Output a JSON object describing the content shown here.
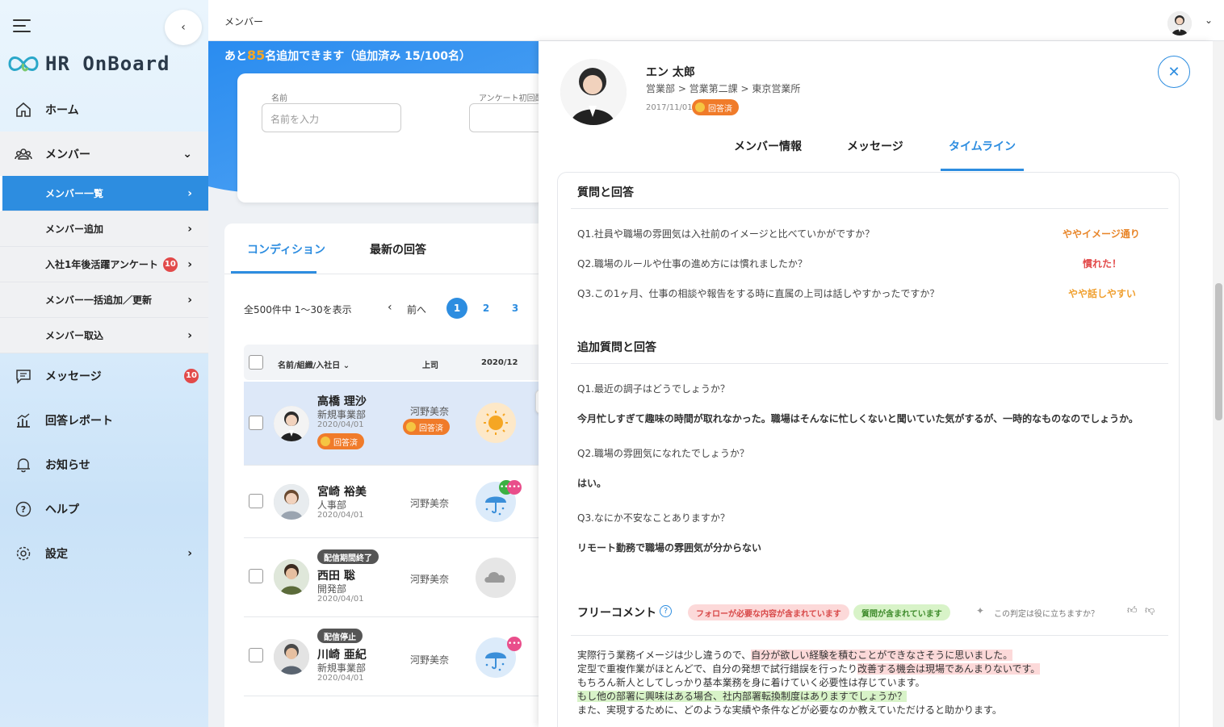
{
  "app": {
    "name": "HR OnBoard"
  },
  "topbar": {
    "breadcrumb": "メンバー"
  },
  "sidebar": {
    "items": [
      {
        "label": "ホーム",
        "icon": "home-icon"
      },
      {
        "label": "メンバー",
        "icon": "members-icon"
      },
      {
        "label": "メッセージ",
        "icon": "message-icon",
        "badge": "10"
      },
      {
        "label": "回答レポート",
        "icon": "report-icon"
      },
      {
        "label": "お知らせ",
        "icon": "bell-icon"
      },
      {
        "label": "ヘルプ",
        "icon": "help-icon"
      },
      {
        "label": "設定",
        "icon": "gear-icon"
      }
    ],
    "subitems": [
      {
        "label": "メンバー一覧"
      },
      {
        "label": "メンバー追加"
      },
      {
        "label": "入社1年後活躍アンケート",
        "badge": "10"
      },
      {
        "label": "メンバー一括追加／更新"
      },
      {
        "label": "メンバー取込"
      }
    ]
  },
  "banner": {
    "prefix": "あと",
    "count": "85",
    "suffix": "名追加できます（追加済み 15/100名）"
  },
  "filter": {
    "name_label": "名前",
    "name_placeholder": "名前を入力",
    "survey_label": "アンケート初回配"
  },
  "list": {
    "tabs": [
      "コンディション",
      "最新の回答"
    ],
    "summary": "全500件中 1〜30を表示",
    "prev": "前へ",
    "pages": [
      "1",
      "2",
      "3"
    ],
    "columns": [
      "名前/組織/入社日",
      "上司",
      "2020/12"
    ],
    "rows": [
      {
        "name": "高橋 理沙",
        "dept": "新規事業部",
        "date": "2020/04/01",
        "boss": "河野美奈",
        "status": "回答済",
        "boss_status": "回答済",
        "weather": "sunny"
      },
      {
        "name": "宮崎 裕美",
        "dept": "人事部",
        "date": "2020/04/01",
        "boss": "河野美奈",
        "weather": "rainy"
      },
      {
        "name": "西田 聡",
        "dept": "開発部",
        "date": "2020/04/01",
        "boss": "河野美奈",
        "tag": "配信期間終了",
        "weather": "cloudy"
      },
      {
        "name": "川崎 亜紀",
        "dept": "新規事業部",
        "date": "2020/04/01",
        "boss": "河野美奈",
        "tag": "配信停止",
        "weather": "rainy"
      }
    ]
  },
  "panel": {
    "name": "エン 太郎",
    "dept": "営業部 > 営業第二課 > 東京営業所",
    "date": "2017/11/01",
    "status": "回答済",
    "tabs": [
      "メンバー情報",
      "メッセージ",
      "タイムライン"
    ],
    "qa_title": "質問と回答",
    "qa": [
      {
        "q": "Q1.社員や職場の雰囲気は入社前のイメージと比べていかがですか？",
        "a": "ややイメージ通り",
        "color": "#e8862a"
      },
      {
        "q": "Q2.職場のルールや仕事の進め方には慣れましたか？",
        "a": "慣れた！",
        "color": "#e24a4a"
      },
      {
        "q": "Q3.この1ヶ月、仕事の相談や報告をする時に直属の上司は話しやすかったですか？",
        "a": "やや話しやすい",
        "color": "#f0a030"
      }
    ],
    "extra_title": "追加質問と回答",
    "extra": [
      {
        "q": "Q1.最近の調子はどうでしょうか？",
        "a": "今月忙しすぎて趣味の時間が取れなかった。職場はそんなに忙しくないと聞いていた気がするが、一時的なものなのでしょうか。"
      },
      {
        "q": "Q2.職場の雰囲気になれたでしょうか？",
        "a": "はい。"
      },
      {
        "q": "Q3.なにか不安なことありますか？",
        "a": "リモート勤務で職場の雰囲気が分からない"
      }
    ],
    "free_title": "フリーコメント",
    "free_tags": [
      "フォローが必要な内容が含まれています",
      "質問が含まれています"
    ],
    "feedback": "この判定は役に立ちますか？",
    "comment": [
      {
        "pre": "実際行う業務イメージは少し違うので、",
        "hl": "自分が欲しい経験を積むことができなさそうに思いました。",
        "kind": "r"
      },
      {
        "pre": "定型で重複作業がほとんどで、自分の発想で試行錯誤を行ったり",
        "hl": "改善する機会は現場であんまりないです。",
        "kind": "r"
      },
      {
        "pre": "もちろん新人としてしっかり基本業務を身に着けていく必要性は存じています。",
        "hl": "",
        "kind": ""
      },
      {
        "pre": "",
        "hl": "もし他の部署に興味はある場合、社内部署転換制度はありますでしょうか？",
        "kind": "g"
      },
      {
        "pre": "また、実現するために、どのような実績や条件などが必要なのか教えていただけると助かります。",
        "hl": "",
        "kind": ""
      }
    ]
  }
}
